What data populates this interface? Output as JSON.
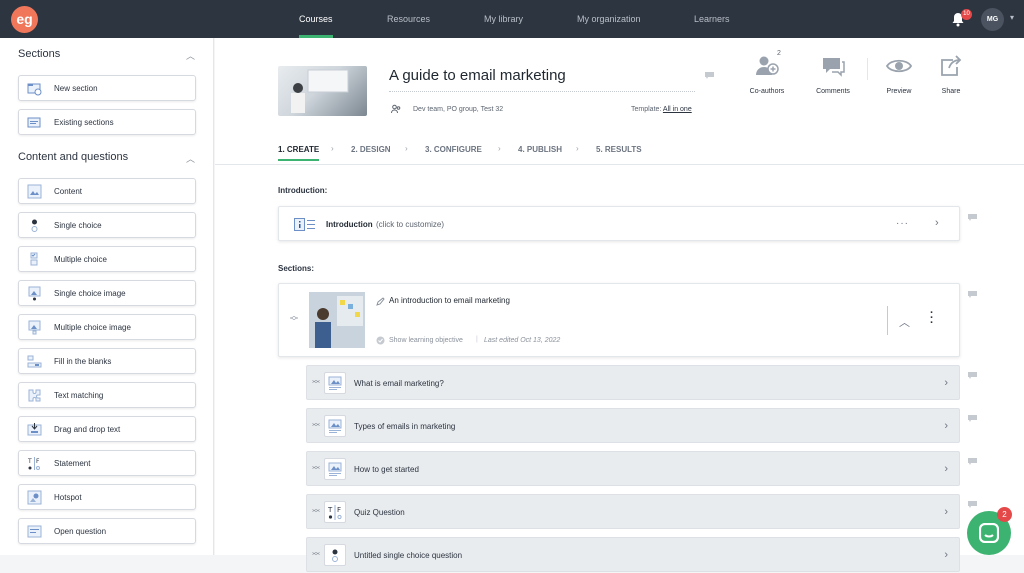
{
  "app": {
    "logo_text": "eg"
  },
  "nav": [
    {
      "label": "Courses",
      "active": true
    },
    {
      "label": "Resources"
    },
    {
      "label": "My library"
    },
    {
      "label": "My organization"
    },
    {
      "label": "Learners"
    }
  ],
  "user": {
    "initials": "MG",
    "notification_count": "10"
  },
  "sidebar": {
    "sections_heading": "Sections",
    "section_items": [
      "New section",
      "Existing sections"
    ],
    "content_heading": "Content and questions",
    "content_items": [
      "Content",
      "Single choice",
      "Multiple choice",
      "Single choice image",
      "Multiple choice image",
      "Fill in the blanks",
      "Text matching",
      "Drag and drop text",
      "Statement",
      "Hotspot",
      "Open question"
    ]
  },
  "course": {
    "title": "A guide to email marketing",
    "team": "Dev team, PO group, Test 32",
    "template_label": "Template:",
    "template_value": "All in one"
  },
  "header_actions": {
    "coauthors_label": "Co-authors",
    "coauthors_count": "2",
    "comments_label": "Comments",
    "preview_label": "Preview",
    "share_label": "Share"
  },
  "steps": [
    "1. CREATE",
    "2. DESIGN",
    "3. CONFIGURE",
    "4. PUBLISH",
    "5. RESULTS"
  ],
  "intro": {
    "heading": "Introduction:",
    "label": "Introduction",
    "hint": "(click to customize)"
  },
  "sections": {
    "heading": "Sections:",
    "section": {
      "title": "An introduction to email marketing",
      "objective_link": "Show learning objective",
      "last_edited": "Last edited Oct 13, 2022"
    },
    "items": [
      {
        "label": "What is email marketing?",
        "icon": "content-icon"
      },
      {
        "label": "Types of emails in marketing",
        "icon": "content-icon"
      },
      {
        "label": "How to get started",
        "icon": "content-icon"
      },
      {
        "label": "Quiz Question",
        "icon": "statement-icon"
      },
      {
        "label": "Untitled single choice question",
        "icon": "single-choice-icon"
      }
    ]
  },
  "chat": {
    "badge": "2"
  },
  "colors": {
    "accent": "#3cb371",
    "topbar": "#2d3540",
    "logo": "#f1775b",
    "badge": "#e54848"
  }
}
